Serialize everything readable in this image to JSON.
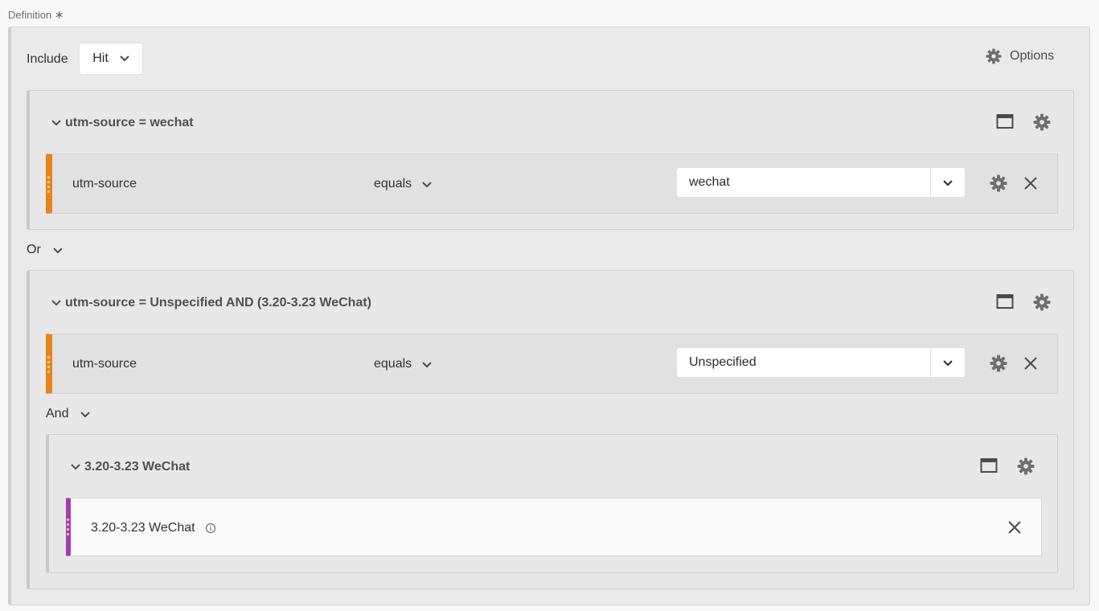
{
  "definition": {
    "label": "Definition",
    "required_mark": "∗"
  },
  "header": {
    "include_label": "Include",
    "hit_value": "Hit",
    "options_label": "Options"
  },
  "containers": [
    {
      "title": "utm-source = wechat",
      "rule": {
        "dimension": "utm-source",
        "operator": "equals",
        "value": "wechat"
      }
    },
    {
      "title": "utm-source = Unspecified AND (3.20-3.23 WeChat)",
      "rule": {
        "dimension": "utm-source",
        "operator": "equals",
        "value": "Unspecified"
      },
      "nested": {
        "title": "3.20-3.23 WeChat",
        "segment": {
          "name": "3.20-3.23 WeChat"
        }
      }
    }
  ],
  "logic": {
    "or_label": "Or",
    "and_label": "And"
  },
  "colors": {
    "dimension_bar": "#e68619",
    "segment_bar": "#a73ab6"
  },
  "icons": [
    "chevron-down-icon",
    "gear-icon",
    "collapse-window-icon",
    "close-icon",
    "info-icon",
    "drag-handle-icon"
  ]
}
